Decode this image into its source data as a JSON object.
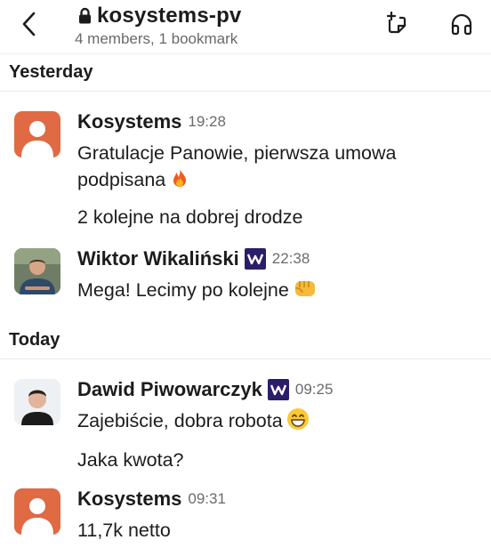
{
  "header": {
    "channel_name": "kosystems-pv",
    "subtitle": "4 members, 1 bookmark"
  },
  "sections": [
    {
      "label": "Yesterday",
      "messages": [
        {
          "author": "Kosystems",
          "time": "19:28",
          "lines": [
            "Gratulacje Panowie, pierwsza umowa",
            "podpisana"
          ],
          "emoji": "fire",
          "extra": "2 kolejne na dobrej drodze"
        },
        {
          "author": "Wiktor Wikaliński",
          "time": "22:38",
          "text": "Mega! Lecimy po kolejne",
          "emoji": "fist"
        }
      ]
    },
    {
      "label": "Today",
      "messages": [
        {
          "author": "Dawid Piwowarczyk",
          "time": "09:25",
          "text": "Zajebiście, dobra robota",
          "emoji": "grin",
          "extra": "Jaka kwota?"
        },
        {
          "author": "Kosystems",
          "time": "09:31",
          "text": "11,7k netto"
        }
      ]
    }
  ],
  "colors": {
    "accent_avatar": "#df6a44",
    "badge": "#2b1d69"
  }
}
